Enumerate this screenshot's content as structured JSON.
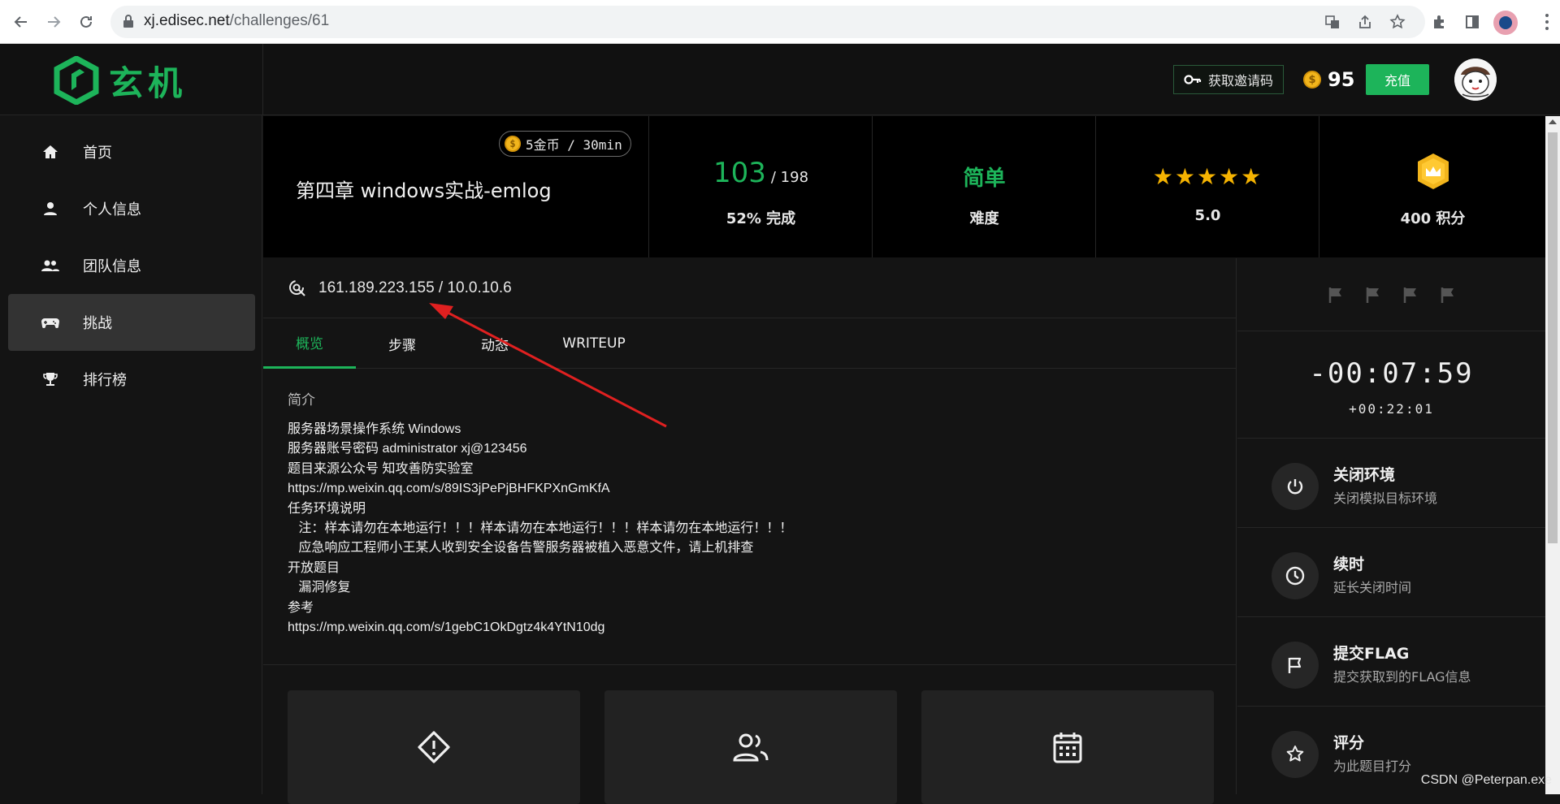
{
  "browser": {
    "url_domain": "xj.edisec.net",
    "url_path": "/challenges/61"
  },
  "header": {
    "logo_text": "玄机",
    "invite_label": "获取邀请码",
    "coin_symbol": "$",
    "coin_count": "95",
    "recharge_label": "充值"
  },
  "sidebar": {
    "items": [
      {
        "label": "首页",
        "icon": "home-icon"
      },
      {
        "label": "个人信息",
        "icon": "person-icon"
      },
      {
        "label": "团队信息",
        "icon": "group-icon"
      },
      {
        "label": "挑战",
        "icon": "gamepad-icon",
        "active": true
      },
      {
        "label": "排行榜",
        "icon": "trophy-icon"
      }
    ]
  },
  "challenge": {
    "title": "第四章 windows实战-emlog",
    "cost": "5金币 / 30min",
    "solved": "103",
    "total": "/ 198",
    "completion": "52% 完成",
    "difficulty": "简单",
    "difficulty_label": "难度",
    "rating_stars": "★★★★★",
    "rating": "5.0",
    "points": "400 积分"
  },
  "target": {
    "address": "161.189.223.155 / 10.0.10.6"
  },
  "tabs": [
    "概览",
    "步骤",
    "动态",
    "WRITEUP"
  ],
  "intro": {
    "heading": "简介",
    "lines": [
      "服务器场景操作系统 Windows",
      "服务器账号密码 administrator xj@123456",
      "题目来源公众号 知攻善防实验室",
      "https://mp.weixin.qq.com/s/89IS3jPePjBHFKPXnGmKfA",
      "任务环境说明",
      "   注：样本请勿在本地运行！！！样本请勿在本地运行！！！样本请勿在本地运行！！！",
      "   应急响应工程师小王某人收到安全设备告警服务器被植入恶意文件，请上机排查",
      "开放题目",
      "   漏洞修复",
      "参考",
      "https://mp.weixin.qq.com/s/1gebC1OkDgtz4k4YtN10dg"
    ]
  },
  "timer": {
    "remaining": "-00:07:59",
    "elapsed": "+00:22:01"
  },
  "actions": [
    {
      "title": "关闭环境",
      "subtitle": "关闭模拟目标环境",
      "icon": "power-icon"
    },
    {
      "title": "续时",
      "subtitle": "延长关闭时间",
      "icon": "clock-icon"
    },
    {
      "title": "提交FLAG",
      "subtitle": "提交获取到的FLAG信息",
      "icon": "flag-icon"
    },
    {
      "title": "评分",
      "subtitle": "为此题目打分",
      "icon": "star-icon"
    }
  ],
  "watermark": "CSDN @Peterpan.exe",
  "colors": {
    "accent": "#1db45a",
    "star": "#f5b301",
    "coin": "#f2b51c"
  }
}
